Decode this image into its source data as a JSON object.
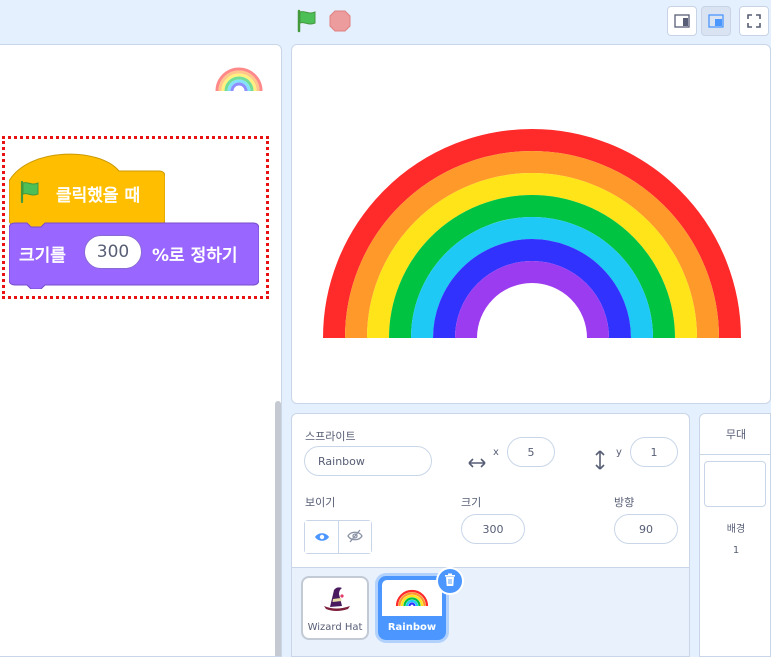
{
  "toolbar": {
    "green_flag_icon": "green-flag-icon",
    "stop_icon": "stop-icon",
    "small_stage_icon": "small-stage-icon",
    "normal_stage_icon": "normal-stage-icon",
    "fullscreen_icon": "fullscreen-icon"
  },
  "code": {
    "hat_block_text": "클릭했을 때",
    "command_prefix": "크기를",
    "command_value": "300",
    "command_suffix": "%로 정하기",
    "colors": {
      "event": "#ffbf00",
      "looks": "#9966ff",
      "highlight": "#e81212"
    }
  },
  "sprite_info": {
    "sprite_label": "스프라이트",
    "sprite_name": "Rainbow",
    "x_label": "x",
    "x_value": "5",
    "y_label": "y",
    "y_value": "1",
    "show_label": "보이기",
    "size_label": "크기",
    "size_value": "300",
    "direction_label": "방향",
    "direction_value": "90"
  },
  "sprites": [
    {
      "name": "Wizard Hat",
      "selected": false
    },
    {
      "name": "Rainbow",
      "selected": true
    }
  ],
  "stage_panel": {
    "title": "무대",
    "backdrop_label": "배경",
    "backdrop_count": "1"
  },
  "rainbow_colors": [
    "#ff2a2a",
    "#ff9a2a",
    "#ffe41a",
    "#00c342",
    "#1ec9f5",
    "#3232ff",
    "#9c3cf0"
  ]
}
